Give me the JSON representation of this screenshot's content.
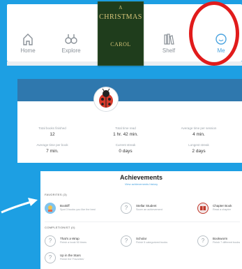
{
  "nav": {
    "items": [
      {
        "label": "Home",
        "icon": "home-icon"
      },
      {
        "label": "Explore",
        "icon": "binoculars-icon"
      },
      {
        "label": "Shelf",
        "icon": "shelf-icon"
      },
      {
        "label": "Me",
        "icon": "user-icon"
      }
    ],
    "active": "Me",
    "book": {
      "line1": "A",
      "line2": "CHRISTMAS",
      "line3": "CAROL"
    },
    "highlight_color": "#e11b1b"
  },
  "stats": {
    "items": [
      {
        "label": "Total books finished",
        "value": "12"
      },
      {
        "label": "Total time read",
        "value": "1 hr. 42 min."
      },
      {
        "label": "Average time per session",
        "value": "4 min."
      },
      {
        "label": "Average time per book",
        "value": "7 min."
      },
      {
        "label": "Current streak",
        "value": "0 days"
      },
      {
        "label": "Longest streak",
        "value": "2 days"
      }
    ],
    "avatar_icon": "ladybug-icon"
  },
  "achievements": {
    "title": "Achievements",
    "subtitle": "View achievements history",
    "sections": [
      {
        "label": "FAVORITES (3)",
        "badges": [
          {
            "name": "Bookiff",
            "desc": "Spot 3 books you like the best",
            "icon": "bookworm-icon"
          },
          {
            "name": "Stellar Student",
            "desc": "Score an achievement",
            "icon": "question-icon"
          },
          {
            "name": "Chapter Book",
            "desc": "Read a chapter",
            "icon": "book-icon"
          }
        ]
      },
      {
        "label": "COMPLETIONIST (0)",
        "badges": [
          {
            "name": "That's a Wrap",
            "desc": "Finish a book 50 times",
            "icon": "question-icon"
          },
          {
            "name": "Scholar",
            "desc": "Finish 5 categorized books",
            "icon": "question-icon"
          },
          {
            "name": "Bookworm",
            "desc": "Finish 7 different books",
            "icon": "question-icon"
          },
          {
            "name": "Up in the Stars",
            "desc": "Finish the 'Favorites'",
            "icon": "question-icon"
          }
        ]
      }
    ]
  }
}
